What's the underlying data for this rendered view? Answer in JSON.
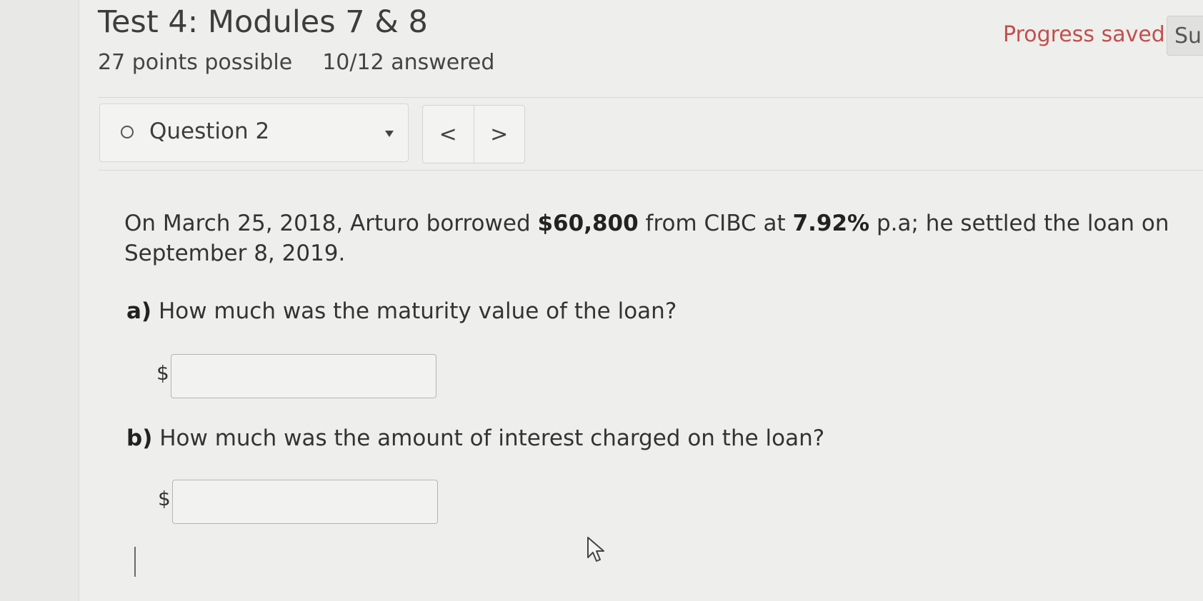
{
  "header": {
    "title": "Test 4: Modules 7 & 8",
    "points": "27 points possible",
    "answered": "10/12 answered",
    "progress_status": "Progress saved",
    "submit_label": "Su"
  },
  "question_nav": {
    "selected": "Question 2",
    "prev_label": "<",
    "next_label": ">"
  },
  "problem": {
    "text_1": "On March 25, 2018, Arturo borrowed ",
    "amount": "$60,800",
    "text_2": " from CIBC at ",
    "rate": "7.92%",
    "text_3": " p.a; he settled the loan on September 8, 2019."
  },
  "parts": [
    {
      "letter": "a)",
      "question": " How much was the maturity value of the loan?",
      "currency": "$",
      "value": ""
    },
    {
      "letter": "b)",
      "question": " How much was the amount of interest charged on the loan?",
      "currency": "$",
      "value": ""
    }
  ],
  "colors": {
    "progress_saved": "#c0504d",
    "background": "#eeeeec"
  },
  "icons": [
    "question-status-circle-icon",
    "dropdown-caret-icon",
    "mouse-pointer-icon"
  ]
}
